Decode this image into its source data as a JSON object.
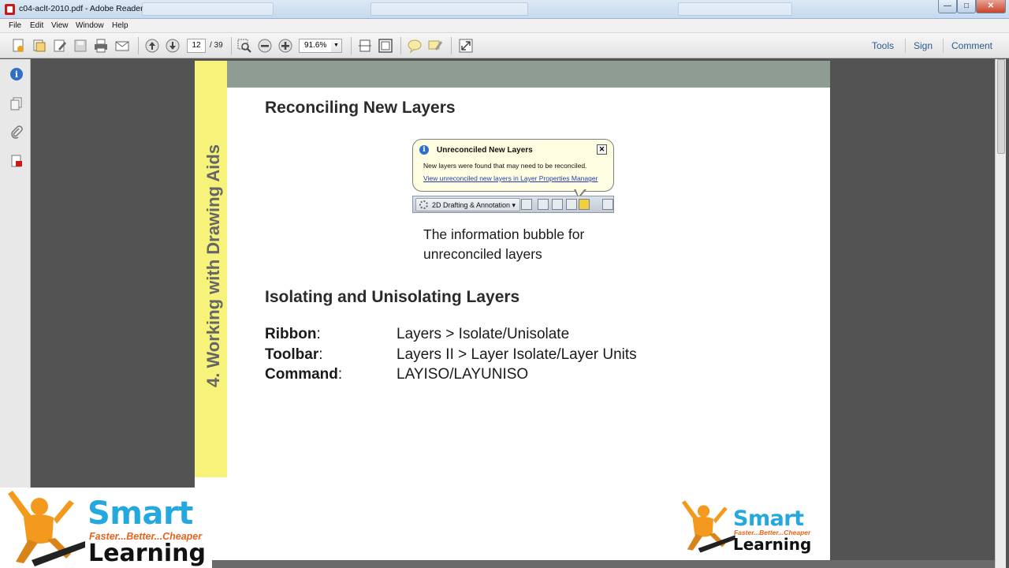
{
  "window": {
    "title": "c04-aclt-2010.pdf - Adobe Reader",
    "controls": {
      "minimize": "—",
      "maximize": "□",
      "close": "✕"
    }
  },
  "menu": [
    "File",
    "Edit",
    "View",
    "Window",
    "Help"
  ],
  "toolbar": {
    "current_page": "12",
    "total_pages": "/ 39",
    "zoom": "91.6%",
    "right_links": [
      "Tools",
      "Sign",
      "Comment"
    ]
  },
  "page": {
    "side_title": "4. Working with Drawing Aids",
    "section1_heading": "Reconciling New Layers",
    "figure": {
      "bubble_title": "Unreconciled New Layers",
      "bubble_message": "New layers were found that may need to be reconciled.",
      "bubble_link": "View unreconciled new layers in Layer Properties Manager",
      "close_glyph": "✕",
      "workspace_label": "2D Drafting & Annotation ▾"
    },
    "caption": "The information bubble for unreconciled layers",
    "section2_heading": "Isolating and Unisolating Layers",
    "rows": [
      {
        "label": "Ribbon",
        "value": "Layers > Isolate/Unisolate"
      },
      {
        "label": "Toolbar",
        "value": "Layers II > Layer Isolate/Layer Units"
      },
      {
        "label": "Command",
        "value": "LAYISO/LAYUNISO"
      }
    ]
  },
  "logo": {
    "word": "Smart",
    "tagline": "Faster...Better...Cheaper",
    "word2": "Learning"
  },
  "icons": [
    "create-pdf-icon",
    "open-icon",
    "edit-icon",
    "save-icon",
    "print-icon",
    "email-icon",
    "page-up-icon",
    "page-down-icon",
    "select-zoom-icon",
    "zoom-out-icon",
    "zoom-in-icon",
    "fit-page-icon",
    "fit-width-icon",
    "comment-icon",
    "highlight-icon",
    "fullscreen-icon",
    "info-icon",
    "pages-icon",
    "attachments-icon",
    "signatures-icon"
  ]
}
